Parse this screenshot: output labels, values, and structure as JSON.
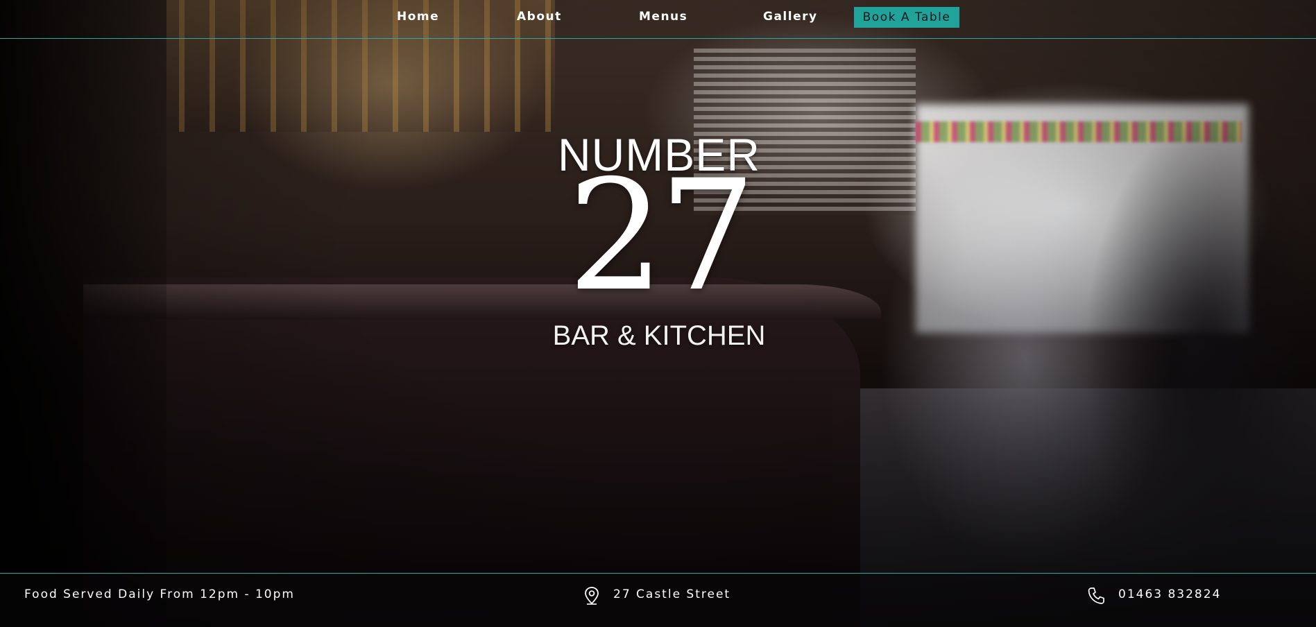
{
  "nav": {
    "items": [
      {
        "label": "Home"
      },
      {
        "label": "About"
      },
      {
        "label": "Menus"
      },
      {
        "label": "Gallery"
      }
    ],
    "cta_label": "Book A Table"
  },
  "logo": {
    "line1": "NUMBER",
    "line2": "27",
    "line3": "BAR & KITCHEN"
  },
  "info": {
    "hours": "Food Served Daily From 12pm - 10pm",
    "address": "27 Castle Street",
    "phone": "01463 832824"
  },
  "colors": {
    "accent": "#1fa39a",
    "rule": "#2aa8a3",
    "text": "#ffffff"
  },
  "icons": {
    "address": "map-pin-icon",
    "phone": "phone-icon"
  }
}
